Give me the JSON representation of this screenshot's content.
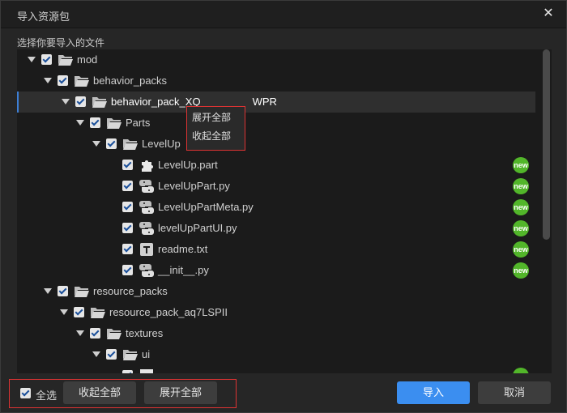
{
  "window": {
    "title": "导入资源包"
  },
  "subtitle": "选择你要导入的文件",
  "tree": [
    {
      "label": "mod",
      "depth": 0,
      "expandable": true,
      "icon": "folder-open-icon"
    },
    {
      "label": "behavior_packs",
      "depth": 1,
      "expandable": true,
      "icon": "folder-open-icon"
    },
    {
      "label": "behavior_pack_XQ",
      "label_tail": "WPR",
      "depth": 2,
      "expandable": true,
      "icon": "folder-open-icon",
      "selected": true
    },
    {
      "label": "Parts",
      "depth": 3,
      "expandable": true,
      "icon": "folder-open-icon"
    },
    {
      "label": "LevelUp",
      "depth": 4,
      "expandable": true,
      "icon": "folder-open-icon"
    },
    {
      "label": "LevelUp.part",
      "depth": 5,
      "expandable": false,
      "icon": "puzzle-icon",
      "badge": "new"
    },
    {
      "label": "LevelUpPart.py",
      "depth": 5,
      "expandable": false,
      "icon": "python-icon",
      "badge": "new"
    },
    {
      "label": "LevelUpPartMeta.py",
      "depth": 5,
      "expandable": false,
      "icon": "python-icon",
      "badge": "new"
    },
    {
      "label": "levelUpPartUI.py",
      "depth": 5,
      "expandable": false,
      "icon": "python-icon",
      "badge": "new"
    },
    {
      "label": "readme.txt",
      "depth": 5,
      "expandable": false,
      "icon": "text-file-icon",
      "badge": "new"
    },
    {
      "label": "__init__.py",
      "depth": 5,
      "expandable": false,
      "icon": "python-icon",
      "badge": "new"
    },
    {
      "label": "resource_packs",
      "depth": 1,
      "expandable": true,
      "icon": "folder-open-icon"
    },
    {
      "label": "resource_pack_aq7LSPII",
      "depth": 2,
      "expandable": true,
      "icon": "folder-open-icon"
    },
    {
      "label": "textures",
      "depth": 3,
      "expandable": true,
      "icon": "folder-open-icon"
    },
    {
      "label": "ui",
      "depth": 4,
      "expandable": true,
      "icon": "folder-open-icon"
    },
    {
      "label": "",
      "depth": 5,
      "expandable": false,
      "icon": "image-file-icon",
      "badge": "new"
    }
  ],
  "context_menu": {
    "expand_all": "展开全部",
    "collapse_all": "收起全部"
  },
  "footer": {
    "select_all": "全选",
    "collapse_all": "收起全部",
    "expand_all": "展开全部",
    "import": "导入",
    "cancel": "取消"
  },
  "colors": {
    "accent": "#3b8ef0",
    "badge": "#52b62a",
    "highlight": "#dd3333"
  }
}
